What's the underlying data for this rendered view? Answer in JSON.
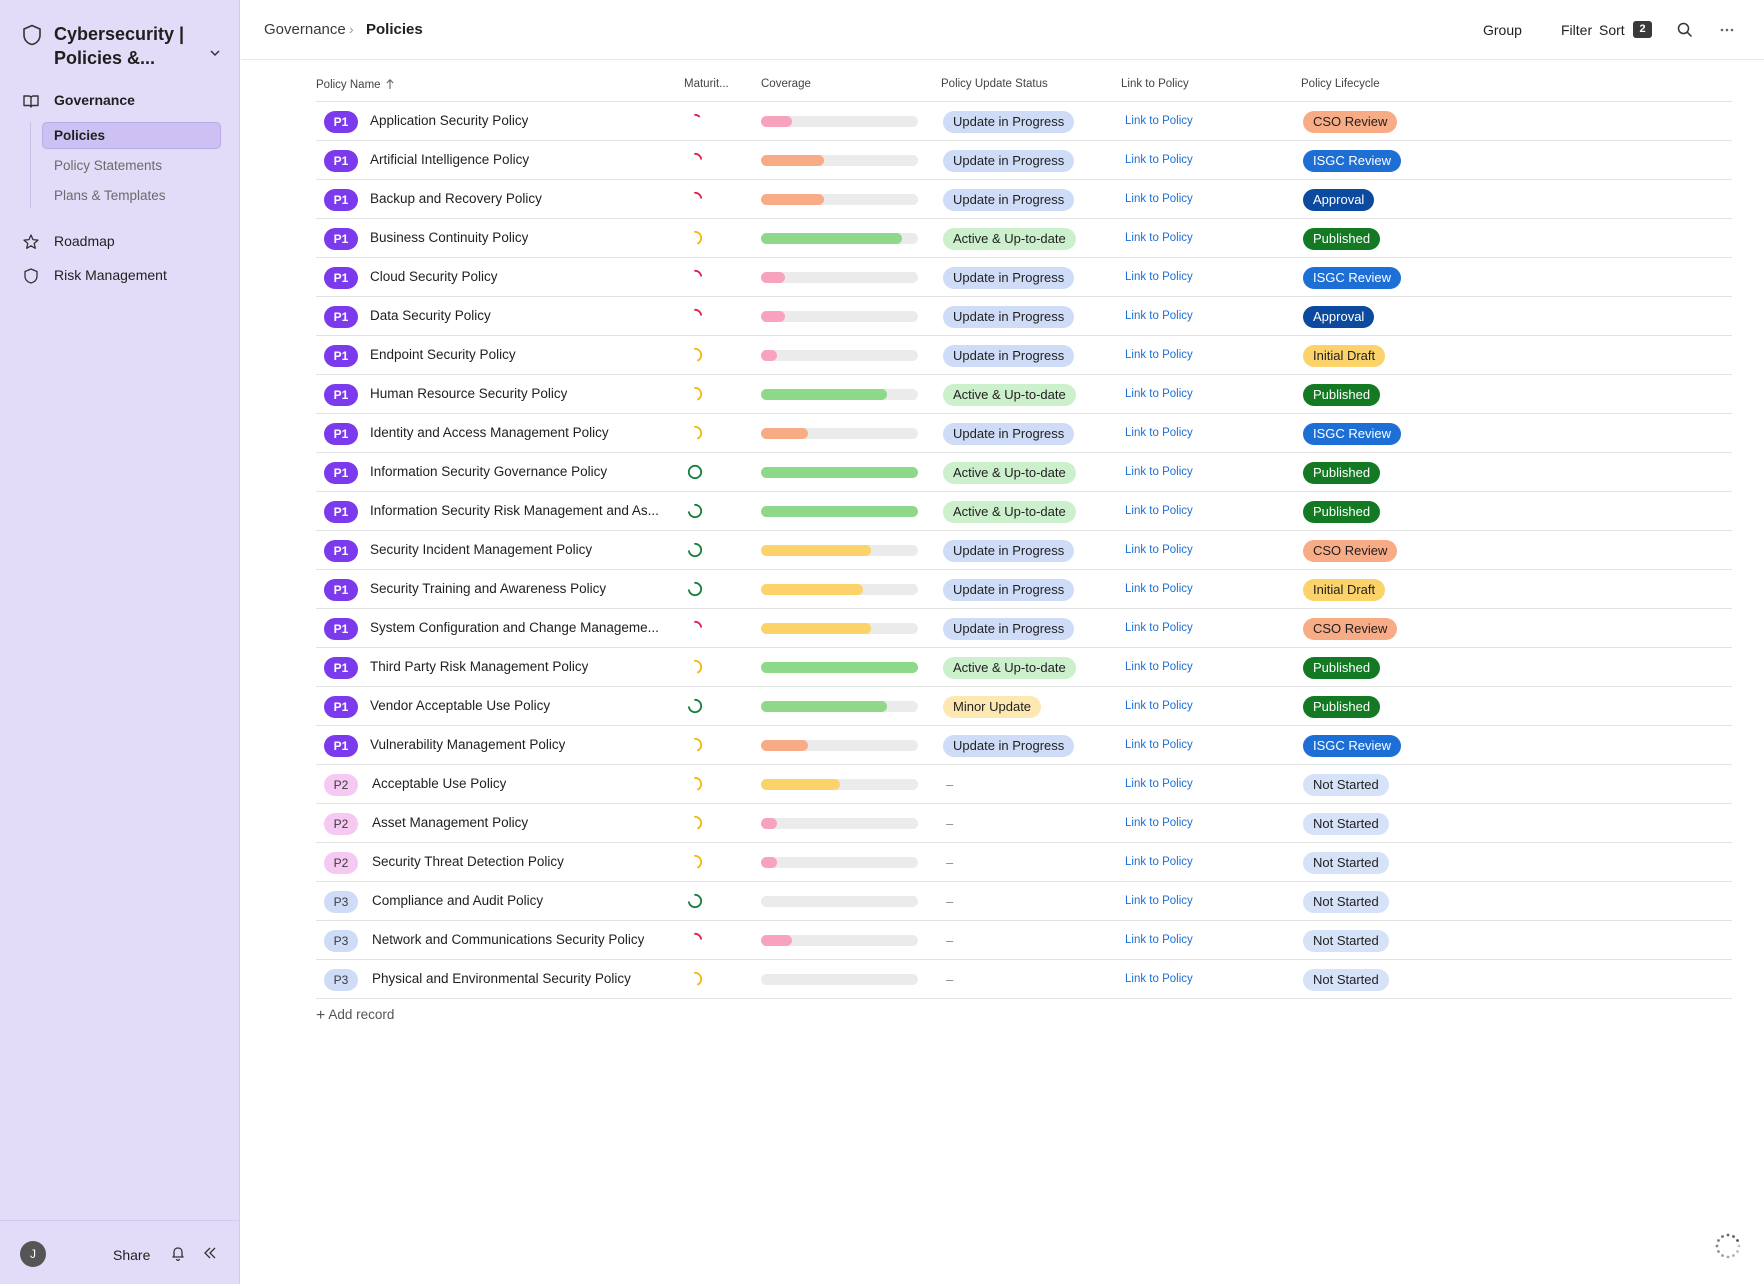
{
  "workspace": {
    "title": "Cybersecurity | Policies &..."
  },
  "sidebar": {
    "governance": "Governance",
    "subitems": [
      "Policies",
      "Policy Statements",
      "Plans & Templates"
    ],
    "roadmap": "Roadmap",
    "risk": "Risk Management"
  },
  "footer": {
    "avatar": "J",
    "share": "Share"
  },
  "header": {
    "breadcrumb": [
      "Governance",
      "Policies"
    ],
    "group": "Group",
    "filter": "Filter",
    "sort": "Sort",
    "sort_count": "2"
  },
  "table": {
    "columns": [
      "Policy Name",
      "Maturit...",
      "Coverage",
      "Policy Update Status",
      "Link to Policy",
      "Policy Lifecycle"
    ],
    "rows": [
      {
        "priority": "P1",
        "name": "Application Security Policy",
        "maturity": 0.12,
        "maturity_color": "#e11d48",
        "coverage": 0.2,
        "coverage_color": "#f7a3be",
        "status": "Update in Progress",
        "link": "Link to Policy",
        "lifecycle": "CSO Review"
      },
      {
        "priority": "P1",
        "name": "Artificial Intelligence Policy",
        "maturity": 0.22,
        "maturity_color": "#e11d48",
        "coverage": 0.4,
        "coverage_color": "#f8ac86",
        "status": "Update in Progress",
        "link": "Link to Policy",
        "lifecycle": "ISGC Review"
      },
      {
        "priority": "P1",
        "name": "Backup and Recovery Policy",
        "maturity": 0.22,
        "maturity_color": "#e11d48",
        "coverage": 0.4,
        "coverage_color": "#f8ac86",
        "status": "Update in Progress",
        "link": "Link to Policy",
        "lifecycle": "Approval"
      },
      {
        "priority": "P1",
        "name": "Business Continuity Policy",
        "maturity": 0.42,
        "maturity_color": "#f2b705",
        "coverage": 0.9,
        "coverage_color": "#8ed88a",
        "status": "Active & Up-to-date",
        "link": "Link to Policy",
        "lifecycle": "Published"
      },
      {
        "priority": "P1",
        "name": "Cloud Security Policy",
        "maturity": 0.22,
        "maturity_color": "#e11d48",
        "coverage": 0.15,
        "coverage_color": "#f7a3be",
        "status": "Update in Progress",
        "link": "Link to Policy",
        "lifecycle": "ISGC Review"
      },
      {
        "priority": "P1",
        "name": "Data Security Policy",
        "maturity": 0.22,
        "maturity_color": "#e11d48",
        "coverage": 0.15,
        "coverage_color": "#f7a3be",
        "status": "Update in Progress",
        "link": "Link to Policy",
        "lifecycle": "Approval"
      },
      {
        "priority": "P1",
        "name": "Endpoint Security Policy",
        "maturity": 0.42,
        "maturity_color": "#f2b705",
        "coverage": 0.1,
        "coverage_color": "#f7a3be",
        "status": "Update in Progress",
        "link": "Link to Policy",
        "lifecycle": "Initial Draft"
      },
      {
        "priority": "P1",
        "name": "Human Resource Security Policy",
        "maturity": 0.42,
        "maturity_color": "#f2b705",
        "coverage": 0.8,
        "coverage_color": "#8ed88a",
        "status": "Active & Up-to-date",
        "link": "Link to Policy",
        "lifecycle": "Published"
      },
      {
        "priority": "P1",
        "name": "Identity and Access Management Policy",
        "maturity": 0.42,
        "maturity_color": "#f2b705",
        "coverage": 0.3,
        "coverage_color": "#f8ac86",
        "status": "Update in Progress",
        "link": "Link to Policy",
        "lifecycle": "ISGC Review"
      },
      {
        "priority": "P1",
        "name": "Information Security Governance Policy",
        "maturity": 1.0,
        "maturity_color": "#15803d",
        "coverage": 1.0,
        "coverage_color": "#8ed88a",
        "status": "Active & Up-to-date",
        "link": "Link to Policy",
        "lifecycle": "Published"
      },
      {
        "priority": "P1",
        "name": "Information Security Risk Management and As...",
        "maturity": 0.72,
        "maturity_color": "#15803d",
        "coverage": 1.0,
        "coverage_color": "#8ed88a",
        "status": "Active & Up-to-date",
        "link": "Link to Policy",
        "lifecycle": "Published"
      },
      {
        "priority": "P1",
        "name": "Security Incident Management Policy",
        "maturity": 0.72,
        "maturity_color": "#15803d",
        "coverage": 0.7,
        "coverage_color": "#fcd36b",
        "status": "Update in Progress",
        "link": "Link to Policy",
        "lifecycle": "CSO Review"
      },
      {
        "priority": "P1",
        "name": "Security Training and Awareness Policy",
        "maturity": 0.72,
        "maturity_color": "#15803d",
        "coverage": 0.65,
        "coverage_color": "#fcd36b",
        "status": "Update in Progress",
        "link": "Link to Policy",
        "lifecycle": "Initial Draft"
      },
      {
        "priority": "P1",
        "name": "System Configuration and Change Manageme...",
        "maturity": 0.22,
        "maturity_color": "#e11d48",
        "coverage": 0.7,
        "coverage_color": "#fcd36b",
        "status": "Update in Progress",
        "link": "Link to Policy",
        "lifecycle": "CSO Review"
      },
      {
        "priority": "P1",
        "name": "Third Party Risk Management Policy",
        "maturity": 0.42,
        "maturity_color": "#f2b705",
        "coverage": 1.0,
        "coverage_color": "#8ed88a",
        "status": "Active & Up-to-date",
        "link": "Link to Policy",
        "lifecycle": "Published"
      },
      {
        "priority": "P1",
        "name": "Vendor Acceptable Use Policy",
        "maturity": 0.72,
        "maturity_color": "#15803d",
        "coverage": 0.8,
        "coverage_color": "#8ed88a",
        "status": "Minor Update",
        "link": "Link to Policy",
        "lifecycle": "Published"
      },
      {
        "priority": "P1",
        "name": "Vulnerability Management Policy",
        "maturity": 0.42,
        "maturity_color": "#f2b705",
        "coverage": 0.3,
        "coverage_color": "#f8ac86",
        "status": "Update in Progress",
        "link": "Link to Policy",
        "lifecycle": "ISGC Review"
      },
      {
        "priority": "P2",
        "name": "Acceptable Use Policy",
        "maturity": 0.42,
        "maturity_color": "#f2b705",
        "coverage": 0.5,
        "coverage_color": "#fcd36b",
        "status": "–",
        "link": "Link to Policy",
        "lifecycle": "Not Started"
      },
      {
        "priority": "P2",
        "name": "Asset Management Policy",
        "maturity": 0.42,
        "maturity_color": "#f2b705",
        "coverage": 0.1,
        "coverage_color": "#f7a3be",
        "status": "–",
        "link": "Link to Policy",
        "lifecycle": "Not Started"
      },
      {
        "priority": "P2",
        "name": "Security Threat Detection Policy",
        "maturity": 0.42,
        "maturity_color": "#f2b705",
        "coverage": 0.1,
        "coverage_color": "#f7a3be",
        "status": "–",
        "link": "Link to Policy",
        "lifecycle": "Not Started"
      },
      {
        "priority": "P3",
        "name": "Compliance and Audit Policy",
        "maturity": 0.72,
        "maturity_color": "#15803d",
        "coverage": 0.0,
        "coverage_color": "#f7a3be",
        "status": "–",
        "link": "Link to Policy",
        "lifecycle": "Not Started"
      },
      {
        "priority": "P3",
        "name": "Network and Communications Security Policy",
        "maturity": 0.22,
        "maturity_color": "#e11d48",
        "coverage": 0.2,
        "coverage_color": "#f7a3be",
        "status": "–",
        "link": "Link to Policy",
        "lifecycle": "Not Started"
      },
      {
        "priority": "P3",
        "name": "Physical and Environmental Security Policy",
        "maturity": 0.42,
        "maturity_color": "#f2b705",
        "coverage": 0.0,
        "coverage_color": "#f7a3be",
        "status": "–",
        "link": "Link to Policy",
        "lifecycle": "Not Started"
      }
    ],
    "add_record": "Add record"
  },
  "status_colors": {
    "Update in Progress": "#cfdcf7",
    "Active & Up-to-date": "#ccefcc",
    "Minor Update": "#fde8b2"
  },
  "lifecycle_colors": {
    "CSO Review": {
      "bg": "#f8ac86",
      "fg": "#1f1f1f"
    },
    "ISGC Review": {
      "bg": "#1d6fd6",
      "fg": "#ffffff"
    },
    "Approval": {
      "bg": "#0b4a9e",
      "fg": "#ffffff"
    },
    "Published": {
      "bg": "#137a23",
      "fg": "#ffffff"
    },
    "Initial Draft": {
      "bg": "#fcd36b",
      "fg": "#1f1f1f"
    },
    "Not Started": {
      "bg": "#d6e2f7",
      "fg": "#1f1f1f"
    }
  }
}
